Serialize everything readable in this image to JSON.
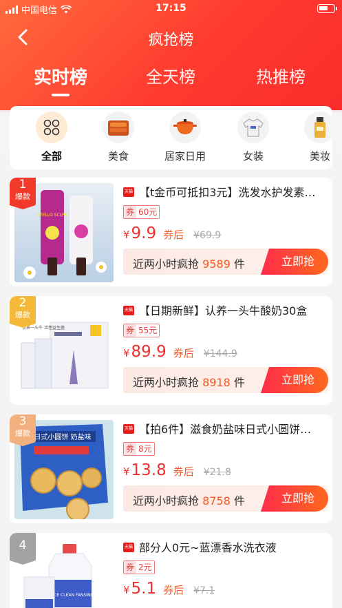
{
  "status_bar": {
    "carrier": "中国电信",
    "time": "17:15"
  },
  "nav": {
    "title": "疯抢榜"
  },
  "tabs": [
    {
      "label": "实时榜",
      "active": true
    },
    {
      "label": "全天榜",
      "active": false
    },
    {
      "label": "热推榜",
      "active": false
    }
  ],
  "categories": [
    {
      "label": "全部",
      "icon": "grid-icon",
      "active": true
    },
    {
      "label": "美食",
      "icon": "food-icon",
      "active": false
    },
    {
      "label": "居家日用",
      "icon": "pot-icon",
      "active": false
    },
    {
      "label": "女装",
      "icon": "sweater-icon",
      "active": false
    },
    {
      "label": "美妆",
      "icon": "cosmetic-icon",
      "active": false
    }
  ],
  "products": [
    {
      "rank": "1",
      "rank_tag": "爆款",
      "title": "【t金币可抵扣3元】洗发水护发素…",
      "coupon_label": "券",
      "coupon_value": "60元",
      "yen": "¥",
      "price": "9.9",
      "after_label": "券后",
      "orig_price": "¥69.9",
      "sales_prefix": "近两小时疯抢",
      "sales_count": "9589",
      "sales_unit": "件",
      "buy_label": "立即抢"
    },
    {
      "rank": "2",
      "rank_tag": "爆款",
      "title": "【日期新鲜】认养一头牛酸奶30盒",
      "coupon_label": "券",
      "coupon_value": "55元",
      "yen": "¥",
      "price": "89.9",
      "after_label": "券后",
      "orig_price": "¥144.9",
      "sales_prefix": "近两小时疯抢",
      "sales_count": "8918",
      "sales_unit": "件",
      "buy_label": "立即抢"
    },
    {
      "rank": "3",
      "rank_tag": "爆款",
      "title": "【拍6件】滋食奶盐味日式小圆饼…",
      "coupon_label": "券",
      "coupon_value": "8元",
      "yen": "¥",
      "price": "13.8",
      "after_label": "券后",
      "orig_price": "¥21.8",
      "sales_prefix": "近两小时疯抢",
      "sales_count": "8758",
      "sales_unit": "件",
      "buy_label": "立即抢"
    },
    {
      "rank": "4",
      "rank_tag": "",
      "title": "部分人0元~蓝漂香水洗衣液",
      "coupon_label": "券",
      "coupon_value": "2元",
      "yen": "¥",
      "price": "5.1",
      "after_label": "券后",
      "orig_price": "¥7.1",
      "sales_prefix": "",
      "sales_count": "",
      "sales_unit": "",
      "buy_label": ""
    }
  ],
  "product_images": [
    {
      "text": "ATELLO SCLPS"
    },
    {
      "text": "认养一头牛 活性益生菌"
    },
    {
      "text": "日式小圆饼 奶盐味"
    },
    {
      "text": "NICE CLEAN FANSING"
    }
  ],
  "colors": {
    "brand_red": "#ff3b2f",
    "price_red": "#f12e2e",
    "coupon_red": "#e94141"
  }
}
